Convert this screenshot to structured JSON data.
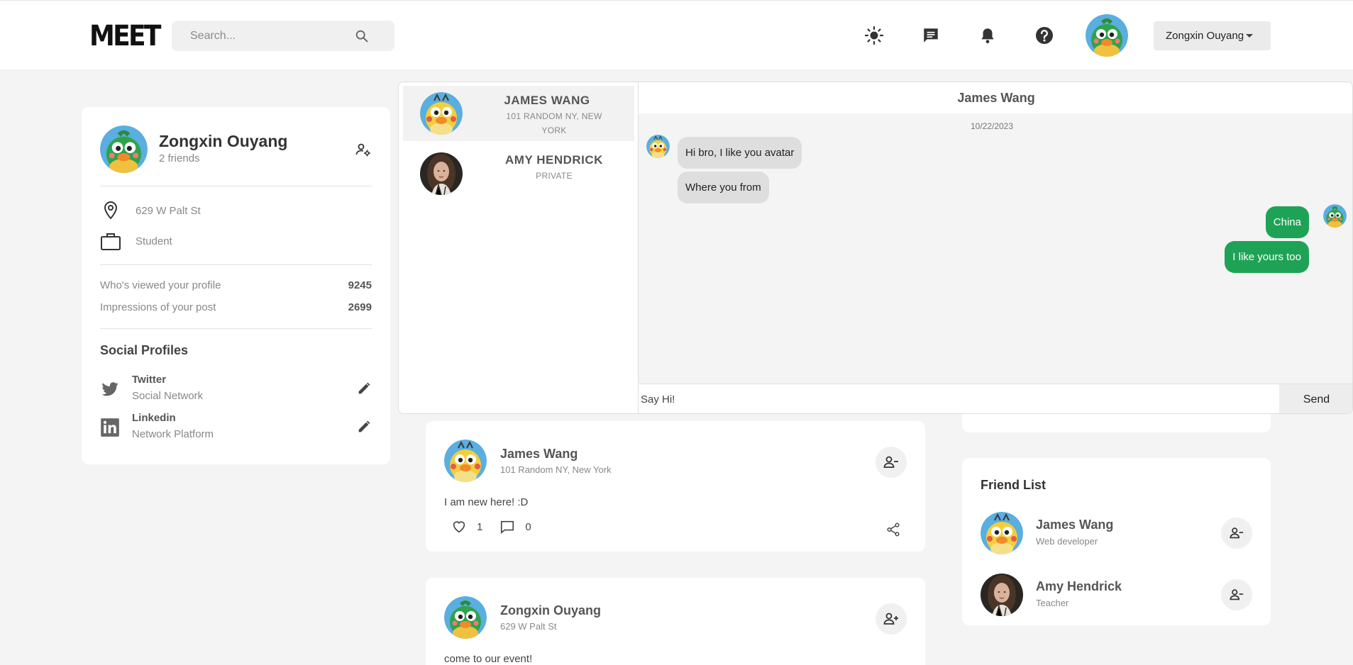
{
  "app": {
    "logo": "MEET"
  },
  "nav": {
    "search_placeholder": "Search...",
    "user_name": "Zongxin Ouyang",
    "icons": [
      "sun-icon",
      "message-icon",
      "bell-icon",
      "help-icon"
    ]
  },
  "profile": {
    "name": "Zongxin Ouyang",
    "friends": "2 friends",
    "location": "629 W Palt St",
    "occupation": "Student",
    "stats": [
      {
        "label": "Who's viewed your profile",
        "value": "9245"
      },
      {
        "label": "Impressions of your post",
        "value": "2699"
      }
    ],
    "social_title": "Social Profiles",
    "social": [
      {
        "name": "Twitter",
        "sub": "Social Network",
        "icon": "twitter-icon"
      },
      {
        "name": "Linkedin",
        "sub": "Network Platform",
        "icon": "linkedin-icon"
      }
    ]
  },
  "chat": {
    "conversations": [
      {
        "name": "JAMES WANG",
        "sub_line1": "101 RANDOM NY, NEW",
        "sub_line2": "YORK",
        "active": true
      },
      {
        "name": "AMY HENDRICK",
        "sub_line1": "PRIVATE",
        "active": false
      }
    ],
    "header": "James Wang",
    "date": "10/22/2023",
    "messages": [
      {
        "from": "them",
        "text": "Hi bro, I like you avatar"
      },
      {
        "from": "them",
        "text": "Where you from"
      },
      {
        "from": "me",
        "text": "China"
      },
      {
        "from": "me",
        "text": "I like yours too"
      }
    ],
    "input_placeholder": "Say Hi!",
    "send_label": "Send"
  },
  "posts": [
    {
      "name": "James Wang",
      "location": "101 Random NY, New York",
      "text": "I am new here! :D",
      "likes": "1",
      "comments": "0",
      "action": "remove-friend"
    },
    {
      "name": "Zongxin Ouyang",
      "location": "629 W Palt St",
      "text": "come to our event!",
      "action": "add-friend"
    }
  ],
  "friend_list": {
    "title": "Friend List",
    "friends": [
      {
        "name": "James Wang",
        "role": "Web developer"
      },
      {
        "name": "Amy Hendrick",
        "role": "Teacher"
      }
    ]
  },
  "colors": {
    "accent_green": "#1ea356",
    "background": "#f4f4f4"
  }
}
